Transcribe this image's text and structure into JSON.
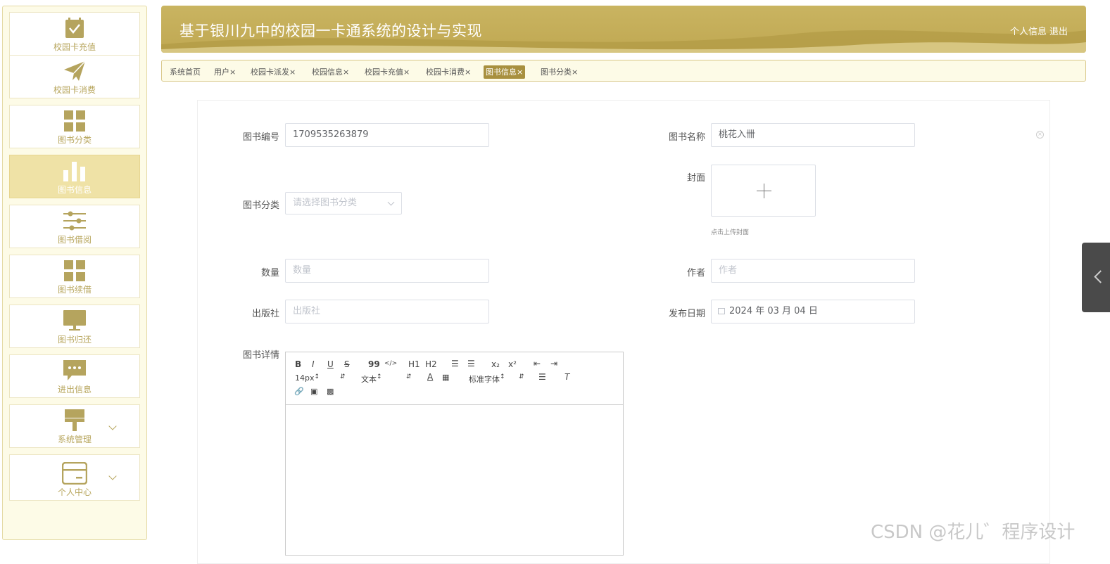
{
  "app": {
    "title": "基于银川九中的校园一卡通系统的设计与实现",
    "profile_link": "个人信息",
    "logout_link": "退出"
  },
  "sidebar": {
    "items": [
      {
        "label": "校园卡充值",
        "icon": "check-icon"
      },
      {
        "label": "校园卡消费",
        "icon": "paper-plane-icon"
      },
      {
        "label": "图书分类",
        "icon": "grid-icon"
      },
      {
        "label": "图书信息",
        "icon": "bar-chart-icon",
        "active": true
      },
      {
        "label": "图书借阅",
        "icon": "sliders-icon"
      },
      {
        "label": "图书续借",
        "icon": "grid-icon"
      },
      {
        "label": "图书归还",
        "icon": "monitor-icon"
      },
      {
        "label": "进出信息",
        "icon": "chat-icon"
      },
      {
        "label": "系统管理",
        "icon": "paint-brush-icon",
        "expandable": true
      },
      {
        "label": "个人中心",
        "icon": "card-icon",
        "expandable": true
      }
    ]
  },
  "tabs": [
    {
      "label": "系统首页",
      "closable": false
    },
    {
      "label": "用户",
      "closable": true
    },
    {
      "label": "校园卡派发",
      "closable": true
    },
    {
      "label": "校园信息",
      "closable": true
    },
    {
      "label": "校园卡充值",
      "closable": true
    },
    {
      "label": "校园卡消费",
      "closable": true
    },
    {
      "label": "图书信息",
      "closable": true,
      "active": true
    },
    {
      "label": "图书分类",
      "closable": true
    }
  ],
  "tab_close_symbol": "×",
  "form": {
    "book_no": {
      "label": "图书编号",
      "value": "1709535263879"
    },
    "book_name": {
      "label": "图书名称",
      "value": "桃花入卌"
    },
    "category": {
      "label": "图书分类",
      "placeholder": "请选择图书分类"
    },
    "cover": {
      "label": "封面",
      "hint": "点击上传封面"
    },
    "quantity": {
      "label": "数量",
      "placeholder": "数量"
    },
    "author": {
      "label": "作者",
      "placeholder": "作者"
    },
    "publisher": {
      "label": "出版社",
      "placeholder": "出版社"
    },
    "publish_date": {
      "label": "发布日期",
      "value": "2024 年 03 月 04 日"
    },
    "details": {
      "label": "图书详情"
    }
  },
  "editor": {
    "font_size": "14px",
    "block_format": "文本",
    "font_family": "标准字体",
    "buttons_row1": [
      "B",
      "I",
      "U",
      "S",
      "99",
      "</>",
      "H1",
      "H2",
      "ol",
      "ul",
      "x₂",
      "x²",
      "outdent",
      "indent"
    ]
  },
  "watermark": "CSDN @花儿゛程序设计",
  "colors": {
    "accent": "#c0a852",
    "active_tab": "#a8903f",
    "sidebar_active": "#efe2a6",
    "sidebar_icon": "#b5a45e"
  }
}
